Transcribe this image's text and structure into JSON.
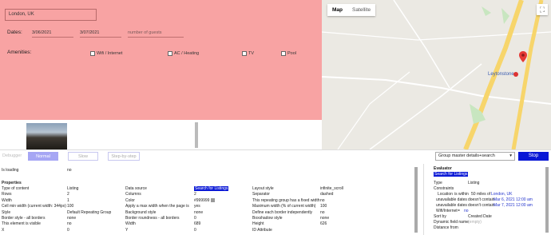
{
  "search": {
    "location": "London, UK",
    "dates_label": "Dates:",
    "date_from": "3/06/2021",
    "date_to": "3/07/2021",
    "guests_placeholder": "number of guests",
    "amenities_label": "Amenities:",
    "amenities": [
      "Wifi / Internet",
      "AC / Heating",
      "TV",
      "Pool"
    ]
  },
  "map": {
    "tabs": [
      "Map",
      "Satellite"
    ],
    "place_label": "Leytonstone",
    "marker_color": "#e53935",
    "fullscreen_icon": "fullscreen-icon"
  },
  "debugger": {
    "debugger_label": "Debugger",
    "normal_label": "Normal",
    "slow_label": "Slow",
    "step_label": "Step-by-step",
    "group_select": "Group master details+search",
    "stop_label": "Stop",
    "accent": "#0a18d6"
  },
  "properties": {
    "loading_key": "Is loading",
    "loading_val": "no",
    "header": "Properties",
    "rows": [
      [
        "Type of content",
        "Listing",
        "Data source",
        "Search for Listings",
        "Layout style",
        "infinite_scroll"
      ],
      [
        "Rows",
        "2",
        "Columns",
        "2",
        "Separator",
        "dashed"
      ],
      [
        "Width",
        "1",
        "Color",
        "#999999",
        "This repeating group has a fixed width",
        "no"
      ],
      [
        "Cell min width (current width: 344px)",
        "100",
        "Apply a max width when the page is",
        "yes",
        "Maximum width (% of current width)",
        "100"
      ],
      [
        "Style",
        "Default Repeating Group",
        "Background style",
        "none",
        "Define each border independently",
        "no"
      ],
      [
        "Border style - all borders",
        "none",
        "Border roundness - all borders",
        "0",
        "Boxshadow style",
        "none"
      ],
      [
        "This element is visible",
        "no",
        "Width",
        "689",
        "Height",
        "626"
      ],
      [
        "X",
        "0",
        "Y",
        "0",
        "ID Attribute",
        ""
      ]
    ]
  },
  "evaluator": {
    "title": "Evaluator",
    "expression": "Search for Listings",
    "type_key": "Type",
    "type_val": "Listing",
    "constraints_key": "Constraints",
    "location_key": "Location",
    "location_op": "is within",
    "location_val": "50 miles of",
    "location_place": "London, UK",
    "unavail1_key": "unavailable dates",
    "unavail1_op": "doesn't contain",
    "unavail1_val": "Mar 6, 2021 12:00 am",
    "unavail2_key": "unavailable dates",
    "unavail2_op": "doesn't contain",
    "unavail2_val": "Mar 7, 2021 12:00 am",
    "wifi_key": "Wifi/Internet",
    "wifi_op": "=",
    "wifi_val": "no",
    "sortby_key": "Sort by",
    "sortby_val": "Created Date",
    "dynamic_key": "Dynamic field name",
    "dynamic_val": "(empty)",
    "distance_key": "Distance from"
  }
}
